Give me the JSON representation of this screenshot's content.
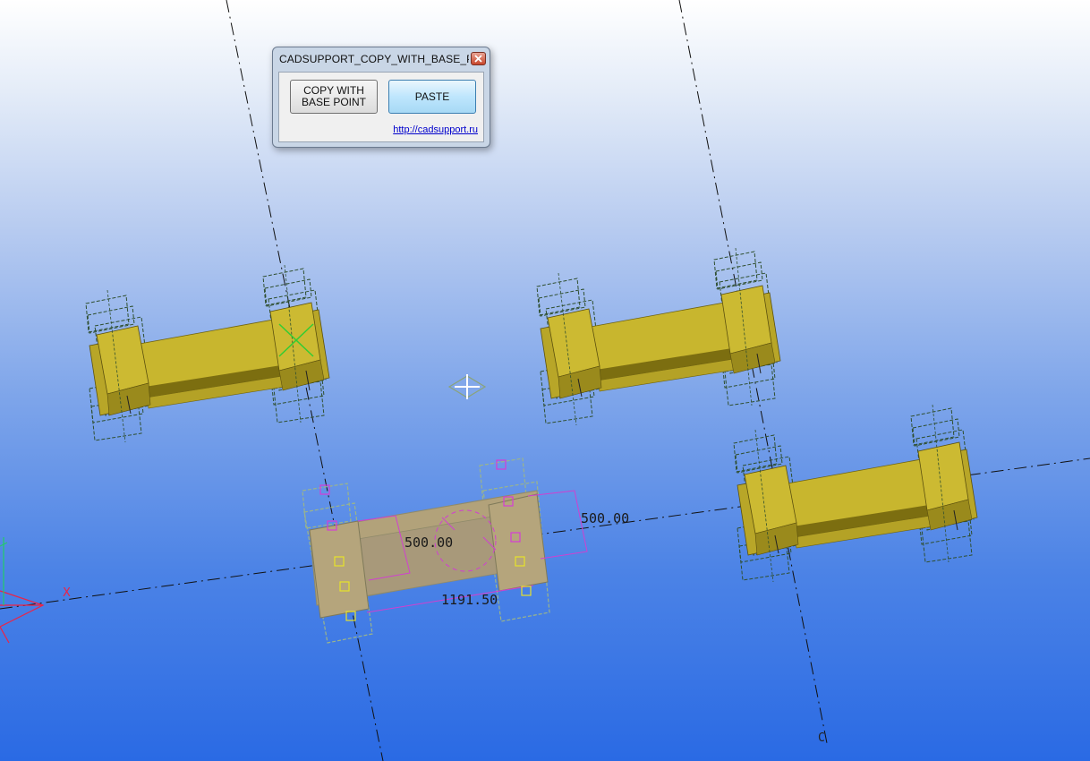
{
  "dialog": {
    "title": "CADSUPPORT_COPY_WITH_BASE_POI...",
    "copy_button_label_line1": "COPY WITH",
    "copy_button_label_line2": "BASE POINT",
    "paste_button_label": "PASTE",
    "link_text": "http://cadsupport.ru"
  },
  "viewport": {
    "dimensions": {
      "top_length": "500.00",
      "side_length": "500.00",
      "total_length": "1191.50"
    },
    "grid_labels": {
      "bottom_right": "C"
    },
    "axis_labels": {
      "x": "X"
    }
  },
  "colors": {
    "part_fill": "#c8b62e",
    "part_dark": "#8f7f14",
    "wire": "#2f4f2f",
    "selected_fill": "#b2a27a",
    "selection_handle": "#d63cd6",
    "snap_point": "#e7e22a",
    "dimension_line": "#d040d0"
  }
}
